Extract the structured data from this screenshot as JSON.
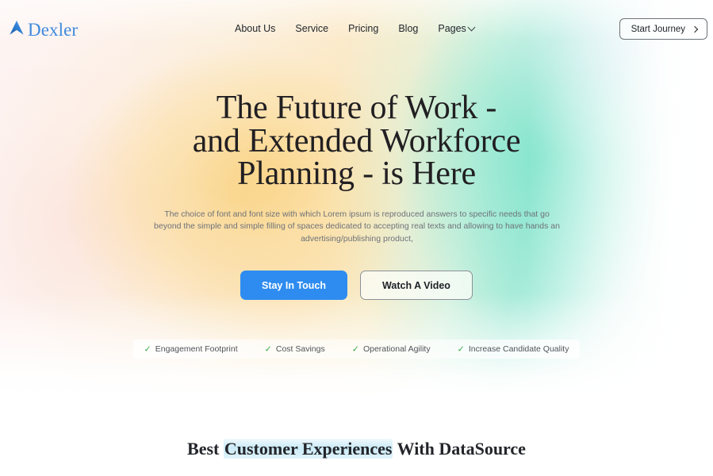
{
  "brand": {
    "name": "Dexler",
    "mark": "arrow-up-logo-icon",
    "color": "#3e89dd"
  },
  "nav": {
    "items": [
      {
        "label": "About Us",
        "has_caret": false
      },
      {
        "label": "Service",
        "has_caret": false
      },
      {
        "label": "Pricing",
        "has_caret": false
      },
      {
        "label": "Blog",
        "has_caret": false
      },
      {
        "label": "Pages",
        "has_caret": true
      }
    ],
    "cta": {
      "label": "Start Journey",
      "icon": "chevron-right-icon"
    }
  },
  "hero": {
    "headline_lines": [
      "The Future of Work -",
      "and Extended Workforce",
      "Planning - is Here"
    ],
    "subcopy": "The choice of font and font size with which Lorem ipsum is reproduced answers to specific needs that go beyond the simple and simple filling of spaces dedicated to accepting real texts and allowing to have hands an advertising/publishing product,",
    "primary_button": {
      "label": "Stay In Touch",
      "color": "#2e8cf0"
    },
    "secondary_button": {
      "label": "Watch A Video"
    }
  },
  "features": {
    "check_icon": "check-icon",
    "check_color": "#3faa4a",
    "items": [
      {
        "label": "Engagement Footprint"
      },
      {
        "label": "Cost Savings"
      },
      {
        "label": "Operational Agility"
      },
      {
        "label": "Increase Candidate Quality"
      }
    ]
  },
  "section": {
    "heading_prefix": "Best ",
    "heading_highlight": "Customer Experiences",
    "heading_suffix": " With DataSource",
    "highlight_color": "#bce5f5"
  }
}
